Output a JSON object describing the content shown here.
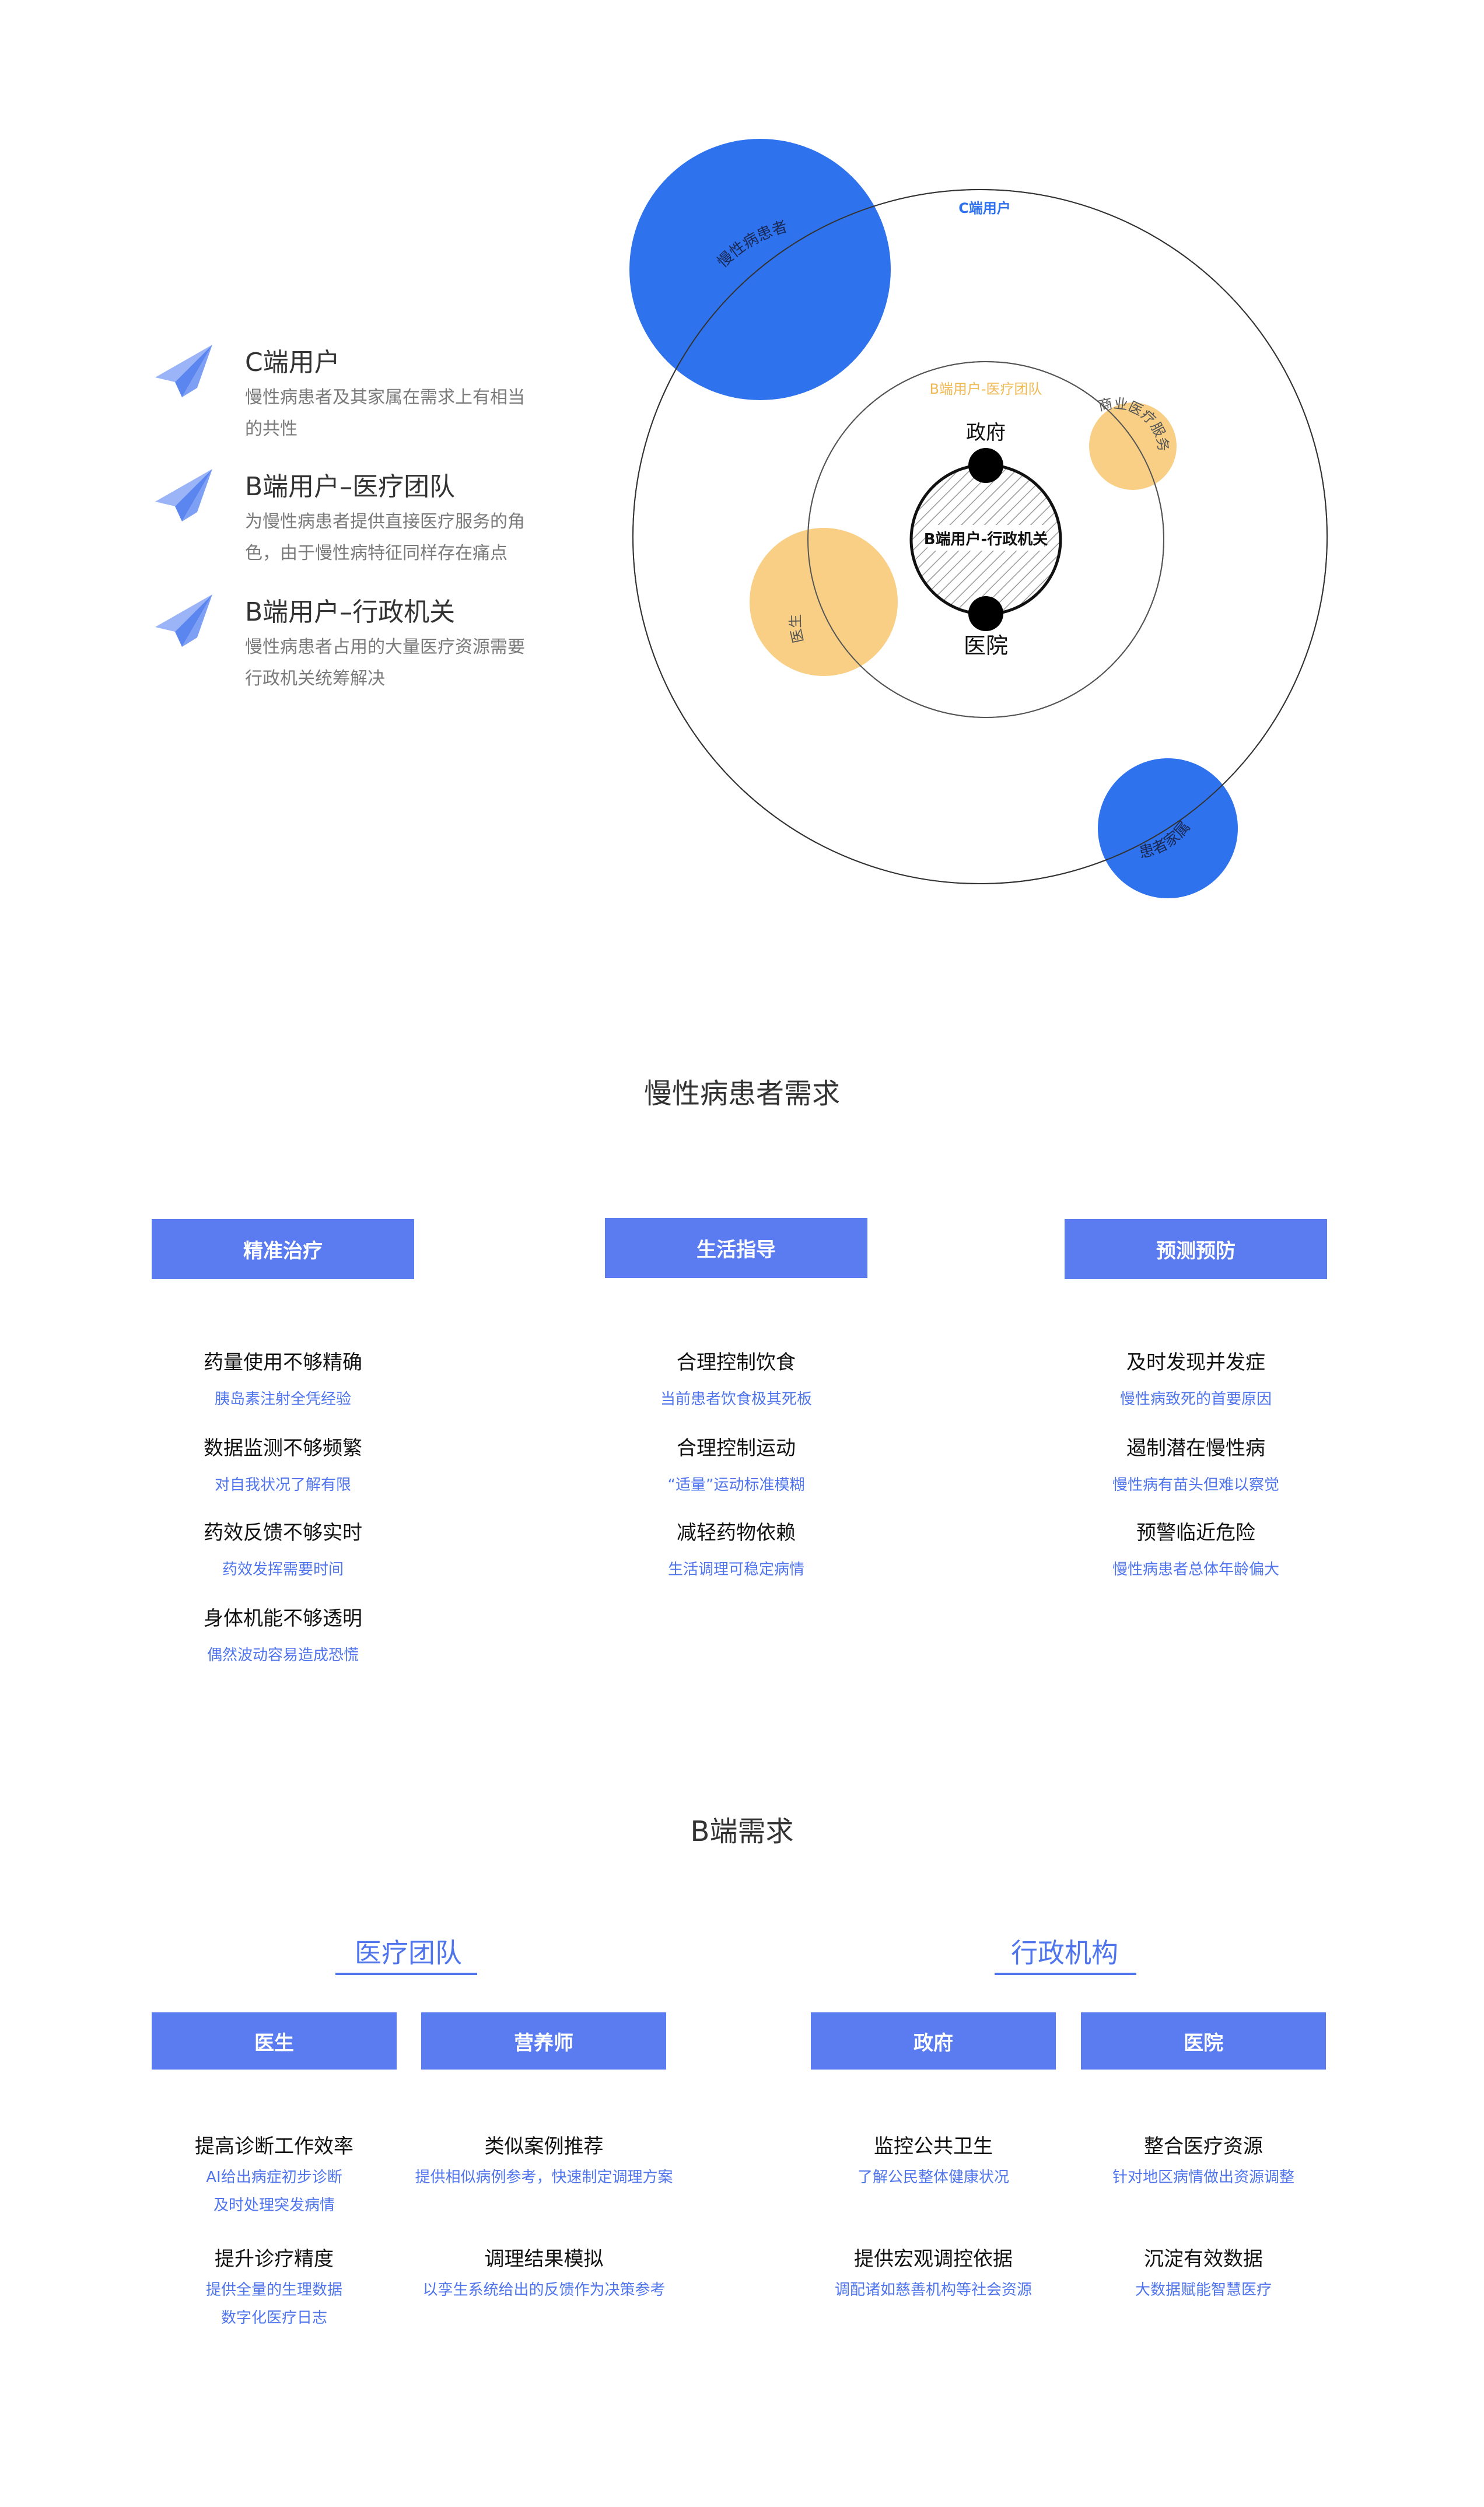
{
  "legend": [
    {
      "title": "C端用户",
      "desc": "慢性病患者及其家属在需求上有相当的共性",
      "icon": "paper-plane-icon"
    },
    {
      "title": "B端用户–医疗团队",
      "desc": "为慢性病患者提供直接医疗服务的角色，由于慢性病特征同样存在痛点",
      "icon": "paper-plane-icon"
    },
    {
      "title": "B端用户–行政机关",
      "desc": "慢性病患者占用的大量医疗资源需要行政机关统筹解决",
      "icon": "paper-plane-icon"
    }
  ],
  "venn": {
    "outer_label": "C端用户",
    "middle_label": "B端用户-医疗团队",
    "inner_label": "B端用户-行政机关",
    "node_top": "政府",
    "node_bottom": "医院",
    "blue_top": "慢性病患者",
    "blue_bottom": "患者家属",
    "orange_right": "商业医疗服务",
    "orange_left": "医生",
    "colors": {
      "blue": "#2f72ee",
      "orange": "#f8cf85",
      "ring": "#555555",
      "outer_label": "#2f72ee",
      "middle_label": "#f0b850"
    }
  },
  "section1": {
    "title": "慢性病患者需求",
    "columns": [
      {
        "header": "精准治疗",
        "items": [
          {
            "title": "药量使用不够精确",
            "sub": "胰岛素注射全凭经验"
          },
          {
            "title": "数据监测不够频繁",
            "sub": "对自我状况了解有限"
          },
          {
            "title": "药效反馈不够实时",
            "sub": "药效发挥需要时间"
          },
          {
            "title": "身体机能不够透明",
            "sub": "偶然波动容易造成恐慌"
          }
        ]
      },
      {
        "header": "生活指导",
        "items": [
          {
            "title": "合理控制饮食",
            "sub": "当前患者饮食极其死板"
          },
          {
            "title": "合理控制运动",
            "sub": "“适量”运动标准模糊"
          },
          {
            "title": "减轻药物依赖",
            "sub": "生活调理可稳定病情"
          }
        ]
      },
      {
        "header": "预测预防",
        "items": [
          {
            "title": "及时发现并发症",
            "sub": "慢性病致死的首要原因"
          },
          {
            "title": "遏制潜在慢性病",
            "sub": "慢性病有苗头但难以察觉"
          },
          {
            "title": "预警临近危险",
            "sub": "慢性病患者总体年龄偏大"
          }
        ]
      }
    ]
  },
  "section2": {
    "title": "B端需求",
    "groups": [
      {
        "heading": "医疗团队",
        "columns": [
          {
            "header": "医生",
            "items": [
              {
                "title": "提高诊断工作效率",
                "sub": [
                  "AI给出病症初步诊断",
                  "及时处理突发病情"
                ]
              },
              {
                "title": "提升诊疗精度",
                "sub": [
                  "提供全量的生理数据",
                  "数字化医疗日志"
                ]
              }
            ]
          },
          {
            "header": "营养师",
            "items": [
              {
                "title": "类似案例推荐",
                "sub": [
                  "提供相似病例参考，快速制定调理方案"
                ]
              },
              {
                "title": "调理结果模拟",
                "sub": [
                  "以孪生系统给出的反馈作为决策参考"
                ]
              }
            ]
          }
        ]
      },
      {
        "heading": "行政机构",
        "columns": [
          {
            "header": "政府",
            "items": [
              {
                "title": "监控公共卫生",
                "sub": [
                  "了解公民整体健康状况"
                ]
              },
              {
                "title": "提供宏观调控依据",
                "sub": [
                  "调配诸如慈善机构等社会资源"
                ]
              }
            ]
          },
          {
            "header": "医院",
            "items": [
              {
                "title": "整合医疗资源",
                "sub": [
                  "针对地区病情做出资源调整"
                ]
              },
              {
                "title": "沉淀有效数据",
                "sub": [
                  "大数据赋能智慧医疗"
                ]
              }
            ]
          }
        ]
      }
    ]
  }
}
